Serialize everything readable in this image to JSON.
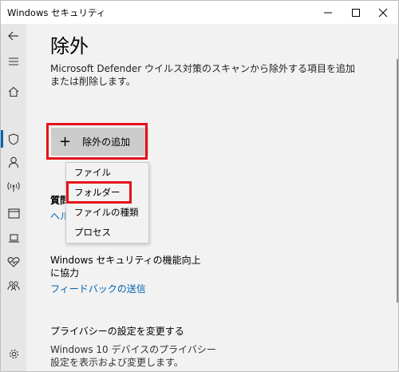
{
  "window": {
    "title": "Windows セキュリティ"
  },
  "sidebar": {
    "items": [
      {
        "icon": "back-arrow-icon"
      },
      {
        "icon": "hamburger-menu-icon"
      },
      {
        "icon": "home-icon"
      },
      {
        "icon": "shield-icon",
        "active": true
      },
      {
        "icon": "person-icon"
      },
      {
        "icon": "wireless-icon"
      },
      {
        "icon": "browser-window-icon"
      },
      {
        "icon": "laptop-icon"
      },
      {
        "icon": "heart-pulse-icon"
      },
      {
        "icon": "family-icon"
      },
      {
        "icon": "gear-icon"
      }
    ],
    "accent_color": "#0063b1"
  },
  "main": {
    "title": "除外",
    "description": "Microsoft Defender ウイルス対策のスキャンから除外する項目を追加または削除します。",
    "add_button": {
      "icon": "+",
      "label": "除外の追加"
    },
    "dropdown": {
      "items": [
        "ファイル",
        "フォルダー",
        "ファイルの種類",
        "プロセス"
      ],
      "highlighted_index": 1
    },
    "help": {
      "title": "質問",
      "link": "ヘル"
    },
    "feedback": {
      "title": "Windows セキュリティの機能向上に協力",
      "link": "フィードバックの送信"
    },
    "privacy": {
      "title": "プライバシーの設定を変更する",
      "description": "Windows 10 デバイスのプライバシー設定を表示および変更します。"
    }
  },
  "colors": {
    "highlight_border": "#e6121a",
    "link": "#0063b1",
    "button_bg": "#cccccc"
  }
}
